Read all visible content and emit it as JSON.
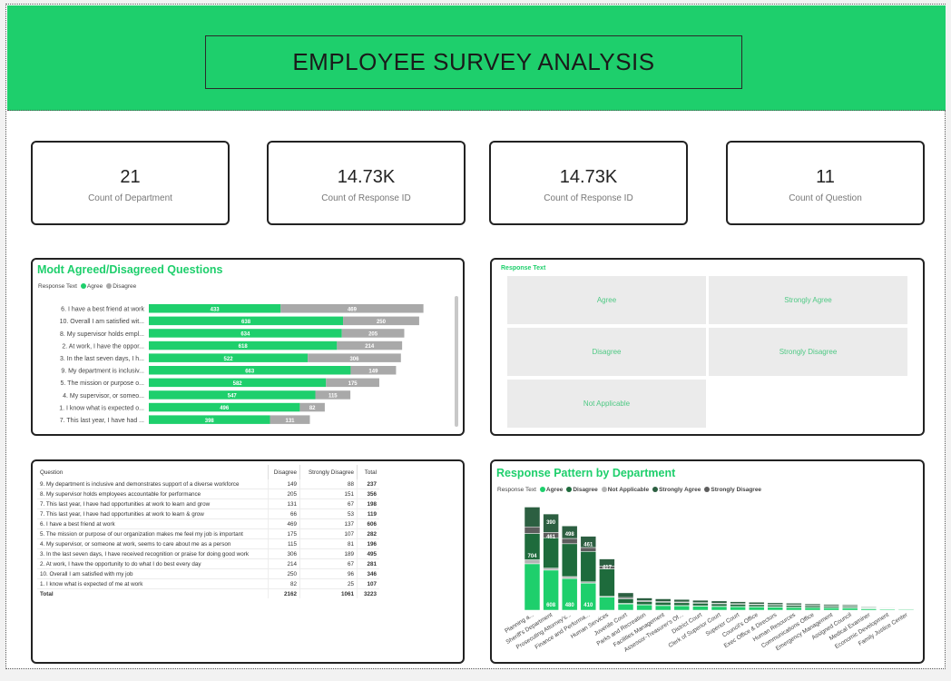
{
  "header": {
    "title": "EMPLOYEE SURVEY ANALYSIS"
  },
  "kpis": [
    {
      "value": "21",
      "label": "Count of Department"
    },
    {
      "value": "14.73K",
      "label": "Count of Response ID"
    },
    {
      "value": "14.73K",
      "label": "Count of Response ID"
    },
    {
      "value": "11",
      "label": "Count of Question"
    }
  ],
  "bar_visual": {
    "title": "Modt Agreed/Disagreed Questions",
    "legend_title": "Response Text",
    "legend": [
      {
        "name": "Agree",
        "color": "#1ecf6c"
      },
      {
        "name": "Disagree",
        "color": "#a9a9a9"
      }
    ]
  },
  "slicer": {
    "title": "Response Text",
    "options": [
      "Agree",
      "Strongly Agree",
      "Disagree",
      "Strongly Disagree",
      "Not Applicable"
    ]
  },
  "table": {
    "headers": [
      "Question",
      "Disagree",
      "Strongly Disagree",
      "Total"
    ],
    "rows": [
      [
        "9. My department is inclusive and demonstrates support of a diverse workforce",
        "149",
        "88",
        "237"
      ],
      [
        "8. My supervisor holds employees accountable for performance",
        "205",
        "151",
        "356"
      ],
      [
        "7. This last year, I have had opportunities at work to learn and grow",
        "131",
        "67",
        "198"
      ],
      [
        "7. This last year, I have had opportunities at work to learn & grow",
        "66",
        "53",
        "119"
      ],
      [
        "6. I have a best friend at work",
        "469",
        "137",
        "606"
      ],
      [
        "5. The mission or purpose of our organization makes me feel my job is important",
        "175",
        "107",
        "282"
      ],
      [
        "4. My supervisor, or someone at work, seems to care about me as a person",
        "115",
        "81",
        "196"
      ],
      [
        "3. In the last seven days, I have received recognition or praise for doing good work",
        "306",
        "189",
        "495"
      ],
      [
        "2. At work, I have the opportunity to do what I do best every day",
        "214",
        "67",
        "281"
      ],
      [
        "10. Overall I am satisfied with my job",
        "250",
        "96",
        "346"
      ],
      [
        "1. I know what is expected of me at work",
        "82",
        "25",
        "107"
      ]
    ],
    "total": [
      "Total",
      "2162",
      "1061",
      "3223"
    ]
  },
  "chart_data": [
    {
      "type": "bar",
      "orientation": "horizontal",
      "stacked": true,
      "title": "Modt Agreed/Disagreed Questions",
      "categories": [
        "6. I have a best friend at work",
        "10. Overall I am satisfied wit...",
        "8. My supervisor holds empl...",
        "2. At work, I have the oppor...",
        "3. In the last seven days, I h...",
        "9. My department is inclusiv...",
        "5. The mission or purpose o...",
        "4. My supervisor, or someo...",
        "1. I know what is expected o...",
        "7. This last year, I have had ..."
      ],
      "series": [
        {
          "name": "Agree",
          "color": "#1ecf6c",
          "values": [
            433,
            638,
            634,
            618,
            522,
            663,
            582,
            547,
            496,
            398
          ]
        },
        {
          "name": "Disagree",
          "color": "#a9a9a9",
          "values": [
            469,
            250,
            205,
            214,
            306,
            149,
            175,
            115,
            82,
            131
          ]
        }
      ]
    },
    {
      "type": "bar",
      "stacked": true,
      "title": "Response Pattern by Department",
      "legend_title": "Response Text",
      "categories": [
        "Planning a...",
        "Sheriff's Department",
        "Prosecuting Attorney's...",
        "Finance and Performa...",
        "Human Services",
        "Juvenile Court",
        "Parks and Recreation",
        "Facilities Management",
        "Assessor-Treasurer's Of...",
        "District Court",
        "Clerk of Superior Court",
        "Superior Court",
        "Council's Office",
        "Exec Office & Directors",
        "Human Resources",
        "Communications Office",
        "Emergency Management",
        "Assigned Council",
        "Medical Examiner",
        "Economic Development",
        "Family Justice Center"
      ],
      "series": [
        {
          "name": "Agree",
          "color": "#1ecf6c",
          "values": [
            704,
            608,
            480,
            410,
            200,
            95,
            80,
            70,
            66,
            62,
            56,
            52,
            50,
            46,
            42,
            38,
            36,
            34,
            22,
            15,
            12
          ]
        },
        {
          "name": "Disagree",
          "color": "#1e6b3c",
          "values": [
            400,
            461,
            498,
            461,
            417,
            70,
            45,
            45,
            42,
            38,
            36,
            34,
            30,
            28,
            28,
            25,
            22,
            20,
            10,
            6,
            4
          ]
        },
        {
          "name": "Not Applicable",
          "color": "#b5b5b5",
          "values": [
            60,
            30,
            30,
            20,
            10,
            8,
            5,
            5,
            5,
            5,
            5,
            4,
            4,
            4,
            4,
            3,
            3,
            3,
            2,
            1,
            1
          ]
        },
        {
          "name": "Strongly Agree",
          "color": "#2c5f41",
          "values": [
            300,
            280,
            190,
            170,
            110,
            70,
            40,
            40,
            38,
            35,
            33,
            30,
            28,
            26,
            24,
            22,
            20,
            18,
            10,
            8,
            6
          ]
        },
        {
          "name": "Strongly Disagree",
          "color": "#5d5d5d",
          "values": [
            100,
            80,
            80,
            60,
            40,
            20,
            15,
            12,
            12,
            10,
            10,
            9,
            9,
            8,
            8,
            7,
            7,
            6,
            4,
            2,
            1
          ]
        }
      ],
      "data_labels": [
        {
          "category": "Planning a...",
          "series": "Agree",
          "value": 704
        },
        {
          "category": "Sheriff's Department",
          "series": "Disagree",
          "value": 390
        },
        {
          "category": "Sheriff's Department",
          "series": "Agree",
          "value": 461
        },
        {
          "category": "Sheriff's Department",
          "series": "Agree",
          "value": 608
        },
        {
          "category": "Prosecuting Attorney's...",
          "series": "Agree",
          "value": 498
        },
        {
          "category": "Prosecuting Attorney's...",
          "series": "Agree",
          "value": 480
        },
        {
          "category": "Finance and Performa...",
          "series": "Agree",
          "value": 461
        },
        {
          "category": "Finance and Performa...",
          "series": "Agree",
          "value": 410
        },
        {
          "category": "Human Services",
          "series": "Agree",
          "value": 417
        }
      ]
    }
  ]
}
